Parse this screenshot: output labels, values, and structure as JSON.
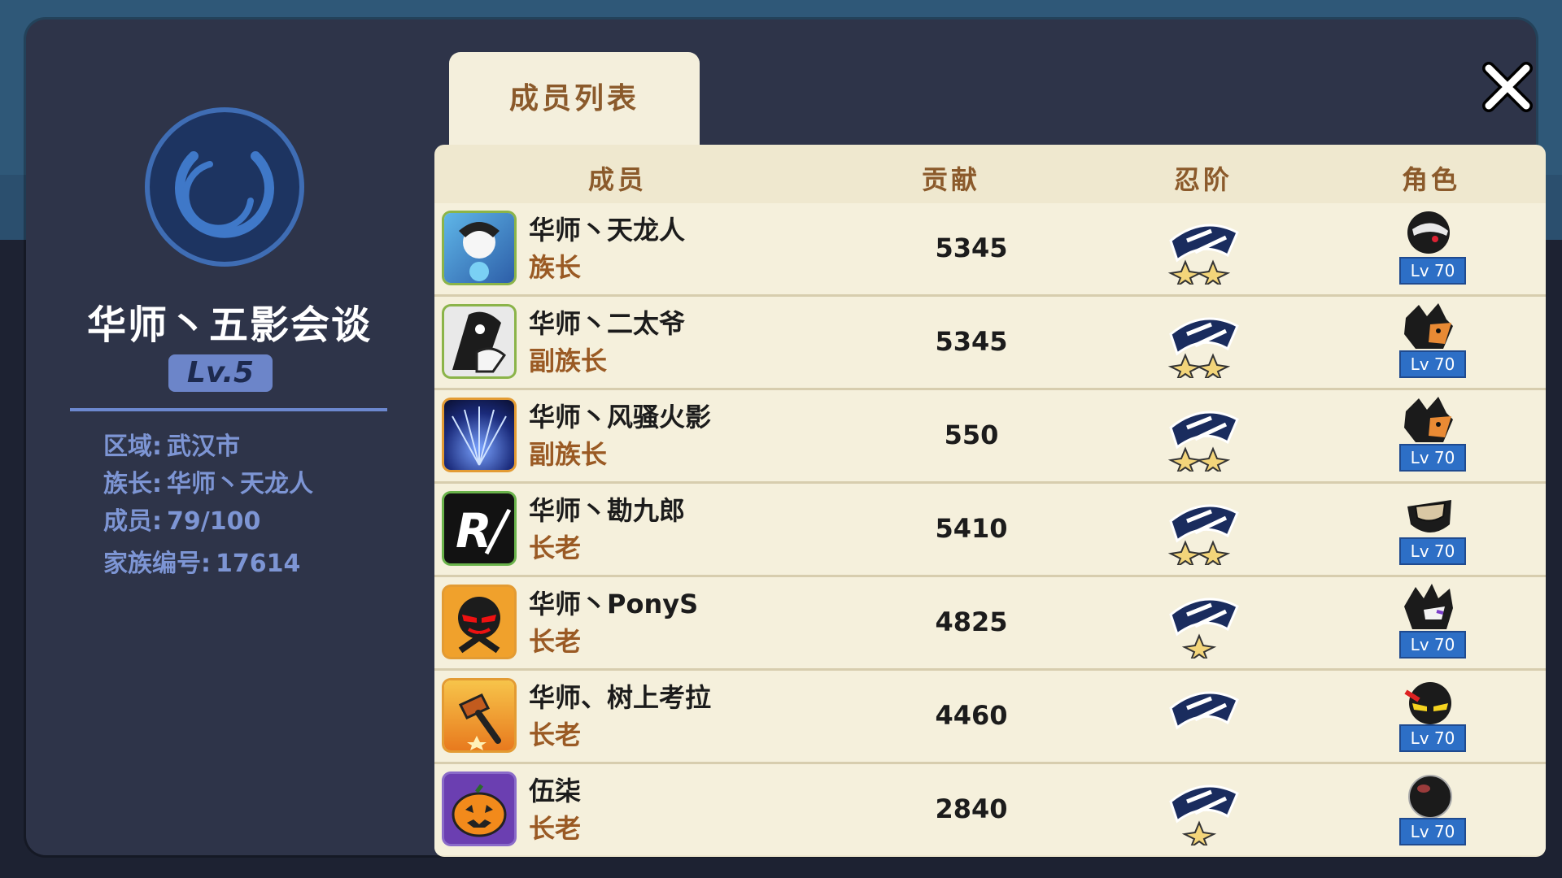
{
  "left_panel": {
    "clan_name": "华师丶五影会谈",
    "level": "Lv.5",
    "region_label": "区域:",
    "region_value": "武汉市",
    "leader_label": "族长:",
    "leader_value": "华师丶天龙人",
    "members_label": "成员:",
    "members_value": "79/100",
    "clan_id_label": "家族编号:",
    "clan_id_value": "17614"
  },
  "tab": {
    "label": "成员列表"
  },
  "table": {
    "headers": {
      "member": "成员",
      "contribution": "贡献",
      "rank": "忍阶",
      "role": "角色"
    },
    "rows": [
      {
        "name": "华师丶天龙人",
        "title": "族长",
        "contribution": "5345",
        "rank_icon": "超忍-rank-icon",
        "level": "Lv 70"
      },
      {
        "name": "华师丶二太爷",
        "title": "副族长",
        "contribution": "5345",
        "rank_icon": "超忍-rank-icon",
        "level": "Lv 70"
      },
      {
        "name": "华师丶风骚火影",
        "title": "副族长",
        "contribution": "550",
        "rank_icon": "超忍-rank-icon",
        "level": "Lv 70"
      },
      {
        "name": "华师丶勘九郎",
        "title": "长老",
        "contribution": "5410",
        "rank_icon": "超忍-rank-icon",
        "level": "Lv 70"
      },
      {
        "name": "华师丶PonyS",
        "title": "长老",
        "contribution": "4825",
        "rank_icon": "超忍-rank-icon",
        "level": "Lv 70"
      },
      {
        "name": "华师、树上考拉",
        "title": "长老",
        "contribution": "4460",
        "rank_icon": "超忍-rank-icon",
        "level": "Lv 70"
      },
      {
        "name": "伍柒",
        "title": "长老",
        "contribution": "2840",
        "rank_icon": "超忍-rank-icon",
        "level": "Lv 70"
      }
    ]
  },
  "colors": {
    "panel": "#2e3449",
    "table_bg": "#efe8cf",
    "header_text": "#8b5a2b",
    "info_text": "#7d95d4",
    "level_badge": "#2d6fc6"
  }
}
